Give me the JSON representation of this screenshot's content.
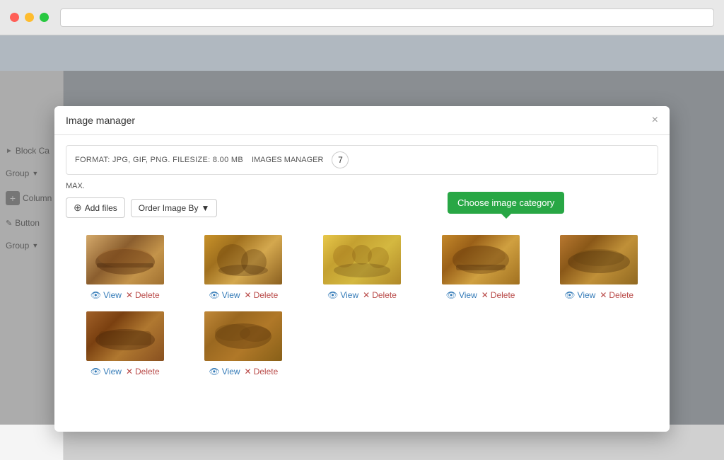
{
  "browser": {
    "traffic_lights": [
      "red",
      "yellow",
      "green"
    ]
  },
  "sidebar": {
    "items": [
      {
        "label": "Block Ca",
        "icon": "chevron-right"
      },
      {
        "label": "Group",
        "icon": "dropdown"
      },
      {
        "label": "Column",
        "icon": "add"
      },
      {
        "label": "Button",
        "icon": "edit"
      },
      {
        "label": "Group",
        "icon": "dropdown"
      }
    ]
  },
  "modal": {
    "title": "Image manager",
    "close_label": "×",
    "info": {
      "format_text": "FORMAT: JPG, GIF, PNG. FILESIZE: 8.00 MB",
      "manager_label": "IMAGES MANAGER",
      "count": "7",
      "max_label": "MAX."
    },
    "toolbar": {
      "add_files_label": "Add files",
      "order_label": "Order Image By",
      "dropdown_arrow": "▼"
    },
    "choose_category_tooltip": "Choose image category",
    "images": [
      {
        "id": 1,
        "thumb_class": "thumb-1",
        "view_label": "View",
        "delete_label": "Delete"
      },
      {
        "id": 2,
        "thumb_class": "thumb-2",
        "view_label": "View",
        "delete_label": "Delete"
      },
      {
        "id": 3,
        "thumb_class": "thumb-3",
        "view_label": "View",
        "delete_label": "Delete"
      },
      {
        "id": 4,
        "thumb_class": "thumb-4",
        "view_label": "View",
        "delete_label": "Delete"
      },
      {
        "id": 5,
        "thumb_class": "thumb-5",
        "view_label": "View",
        "delete_label": "Delete"
      },
      {
        "id": 6,
        "thumb_class": "thumb-6",
        "view_label": "View",
        "delete_label": "Delete"
      },
      {
        "id": 7,
        "thumb_class": "thumb-7",
        "view_label": "View",
        "delete_label": "Delete"
      }
    ]
  }
}
